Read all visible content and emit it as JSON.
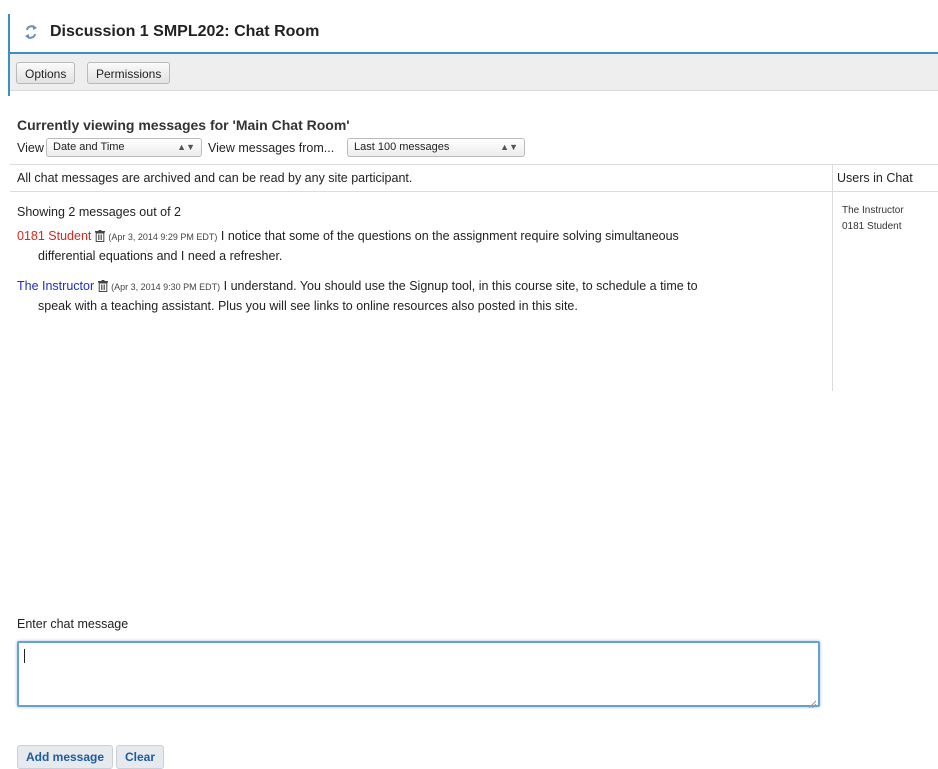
{
  "header": {
    "title": "Discussion 1 SMPL202: Chat Room",
    "icon": "reset-icon"
  },
  "toolbar": {
    "options_label": "Options",
    "permissions_label": "Permissions"
  },
  "view_controls": {
    "heading": "Currently viewing messages for 'Main Chat Room'",
    "view_label": "View",
    "view_select": "Date and Time",
    "from_label": "View messages from...",
    "from_select": "Last 100 messages"
  },
  "archived_note": "All chat messages are archived and can be read by any site participant.",
  "users": {
    "header": "Users in Chat",
    "list": [
      "The Instructor",
      "0181 Student"
    ]
  },
  "messages": {
    "summary": "Showing 2 messages out of 2",
    "items": [
      {
        "sender": "0181 Student",
        "timestamp": "(Apr 3, 2014 9:29 PM EDT)",
        "line1": "I notice that some of the questions on the assignment require solving simultaneous",
        "line2": "differential equations and I need a refresher.",
        "sender_color": "#d9261c"
      },
      {
        "sender": "The Instructor",
        "timestamp": "(Apr 3, 2014 9:30 PM EDT)",
        "line1": "I understand. You should use the Signup tool, in this course site, to schedule a time to",
        "line2": "speak with a teaching assistant. Plus you will see links to online resources also posted in this site.",
        "sender_color": "#1c2ec8"
      }
    ]
  },
  "composer": {
    "label": "Enter chat message",
    "value": "",
    "add_label": "Add message",
    "clear_label": "Clear"
  },
  "colors": {
    "accent": "#3b8fc4",
    "input_focus": "#6a9fd6",
    "button_text": "#1c5b9c"
  }
}
